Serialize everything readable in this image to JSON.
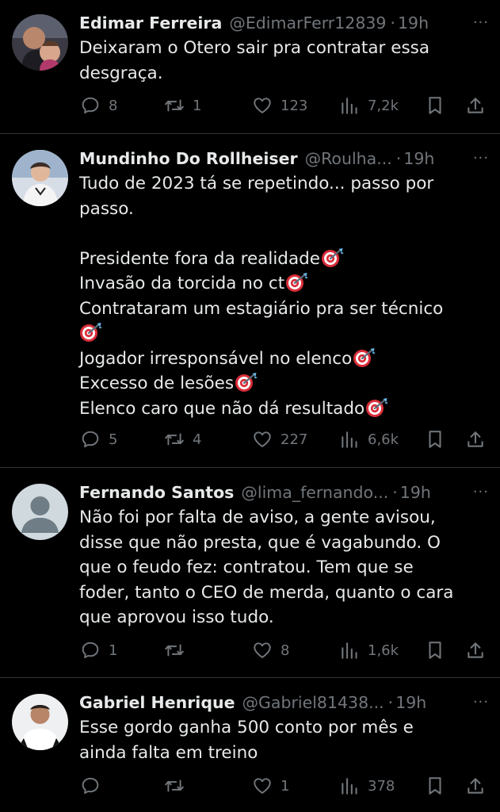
{
  "tweets": [
    {
      "name": "Edimar Ferreira",
      "handle": "@EdimarFerr12839",
      "separator": "·",
      "time": "19h",
      "more": "···",
      "lines": [
        "Deixaram o Otero sair pra contratar essa",
        "desgraça."
      ],
      "replies": "8",
      "retweets": "1",
      "likes": "123",
      "views": "7,2k"
    },
    {
      "name": "Mundinho Do Rollheiser",
      "handle": "@Roulha...",
      "separator": "·",
      "time": "19h",
      "more": "···",
      "lines": [
        "Tudo de 2023 tá se repetindo... passo por",
        "passo.",
        "",
        "Presidente fora da realidade",
        "Invasão da torcida no ct",
        "Contrataram um estagiário pra ser técnico",
        "",
        "Jogador irresponsável no elenco",
        "Excesso de lesões",
        "Elenco caro que não dá resultado"
      ],
      "replies": "5",
      "retweets": "4",
      "likes": "227",
      "views": "6,6k"
    },
    {
      "name": "Fernando Santos",
      "handle": "@lima_fernando...",
      "separator": "·",
      "time": "19h",
      "more": "···",
      "lines": [
        "Não foi por falta de aviso, a gente avisou,",
        "disse que não presta, que é vagabundo. O",
        "que o feudo fez: contratou. Tem que se",
        "foder, tanto o CEO de merda, quanto o cara",
        "que aprovou isso tudo."
      ],
      "replies": "1",
      "retweets": "",
      "likes": "8",
      "views": "1,6k"
    },
    {
      "name": "Gabriel Henrique",
      "handle": "@Gabriel81438...",
      "separator": "·",
      "time": "19h",
      "more": "···",
      "lines": [
        "Esse gordo ganha 500 conto por mês e",
        "ainda falta em treino"
      ],
      "replies": "",
      "retweets": "",
      "likes": "1",
      "views": "378"
    }
  ],
  "icons": {
    "reply": "reply-icon",
    "retweet": "retweet-icon",
    "like": "heart-icon",
    "views": "views-icon",
    "bookmark": "bookmark-icon",
    "share": "share-icon",
    "emoji": "direct-hit-emoji"
  },
  "colors": {
    "background": "#000000",
    "text": "#e7e9ea",
    "secondary": "#71767b",
    "divider": "#2f3336"
  }
}
